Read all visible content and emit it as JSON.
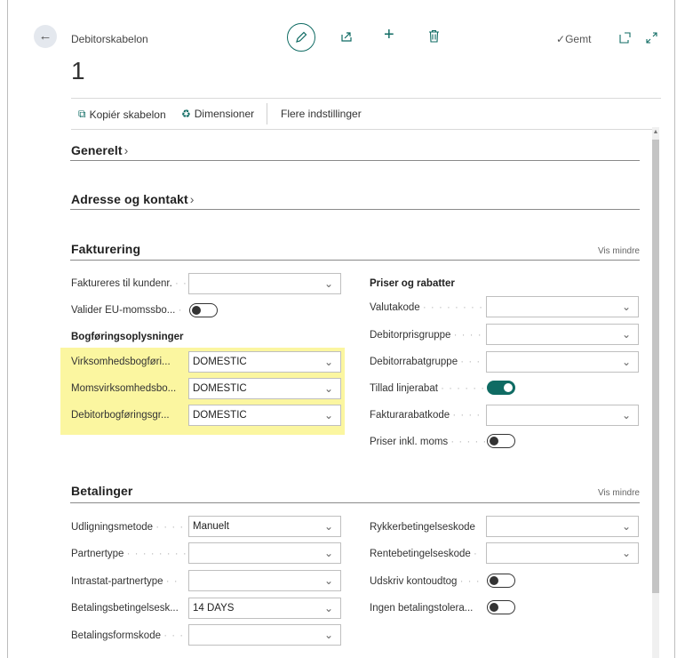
{
  "header": {
    "caption": "Debitorskabelon",
    "record_number": "1",
    "saved_label": "Gemt"
  },
  "actions": {
    "copy_template": "Kopiér skabelon",
    "dimensions": "Dimensioner",
    "more_settings": "Flere indstillinger"
  },
  "sections": {
    "general": "Generelt",
    "address": "Adresse og kontakt",
    "invoicing": "Fakturering",
    "payments": "Betalinger",
    "show_less": "Vis mindre"
  },
  "invoicing": {
    "bill_to": {
      "label": "Faktureres til kundenr.",
      "value": ""
    },
    "validate_eu": {
      "label": "Valider EU-momssbo...",
      "on": false
    },
    "posting_heading": "Bogføringsoplysninger",
    "gen_bus_posting": {
      "label": "Virksomhedsbogføri...",
      "value": "DOMESTIC"
    },
    "vat_bus_posting": {
      "label": "Momsvirksomhedsbo...",
      "value": "DOMESTIC"
    },
    "customer_posting": {
      "label": "Debitorbogføringsgr...",
      "value": "DOMESTIC"
    },
    "prices_heading": "Priser og rabatter",
    "currency": {
      "label": "Valutakode",
      "value": ""
    },
    "price_group": {
      "label": "Debitorprisgruppe",
      "value": ""
    },
    "disc_group": {
      "label": "Debitorrabatgruppe",
      "value": ""
    },
    "allow_line_disc": {
      "label": "Tillad linjerabat",
      "on": true
    },
    "invoice_disc_code": {
      "label": "Fakturarabatkode",
      "value": ""
    },
    "prices_incl_vat": {
      "label": "Priser inkl. moms",
      "on": false
    }
  },
  "payments": {
    "application_method": {
      "label": "Udligningsmetode",
      "value": "Manuelt"
    },
    "partner_type": {
      "label": "Partnertype",
      "value": ""
    },
    "intrastat_partner": {
      "label": "Intrastat-partnertype",
      "value": ""
    },
    "payment_terms": {
      "label": "Betalingsbetingelsesk...",
      "value": "14 DAYS"
    },
    "payment_method": {
      "label": "Betalingsformskode",
      "value": ""
    },
    "reminder_terms": {
      "label": "Rykkerbetingelseskode",
      "value": ""
    },
    "fin_charge_terms": {
      "label": "Rentebetingelseskode",
      "value": ""
    },
    "print_statements": {
      "label": "Udskriv kontoudtog",
      "on": false
    },
    "block_payment_tol": {
      "label": "Ingen betalingstolera...",
      "on": false
    }
  },
  "colors": {
    "accent": "#0f6b63",
    "highlight": "#fbf6a0"
  }
}
